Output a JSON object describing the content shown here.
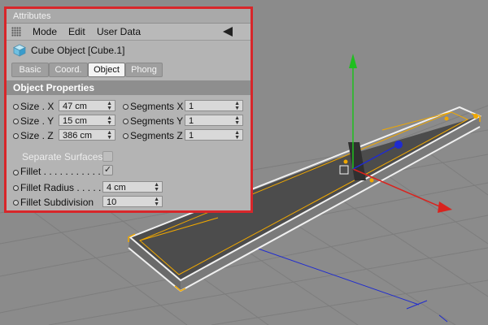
{
  "panel": {
    "title": "Attributes",
    "menu": [
      "Mode",
      "Edit",
      "User Data"
    ],
    "object_label": "Cube Object [Cube.1]",
    "tabs": [
      "Basic",
      "Coord.",
      "Object",
      "Phong"
    ],
    "active_tab": "Object",
    "section_title": "Object Properties",
    "size_x": {
      "label": "Size . X",
      "value": "47 cm"
    },
    "size_y": {
      "label": "Size . Y",
      "value": "15 cm"
    },
    "size_z": {
      "label": "Size . Z",
      "value": "386 cm"
    },
    "seg_x": {
      "label": "Segments X",
      "value": "1"
    },
    "seg_y": {
      "label": "Segments Y",
      "value": "1"
    },
    "seg_z": {
      "label": "Segments Z",
      "value": "1"
    },
    "separate_surfaces": {
      "label": "Separate Surfaces",
      "checked": false
    },
    "fillet": {
      "label": "Fillet . . . . . . . . . . .",
      "checked": true
    },
    "fillet_radius": {
      "label": "Fillet Radius . . . . .",
      "value": "4 cm"
    },
    "fillet_subdivision": {
      "label": "Fillet Subdivision",
      "value": "10"
    }
  },
  "colors": {
    "highlight_border": "#d8262a",
    "selection": "#f0a800",
    "axis_x": "#d9231e",
    "axis_y": "#1fbf1f",
    "axis_z": "#1f2bd0",
    "viewport_bg": "#8b8b8b"
  }
}
